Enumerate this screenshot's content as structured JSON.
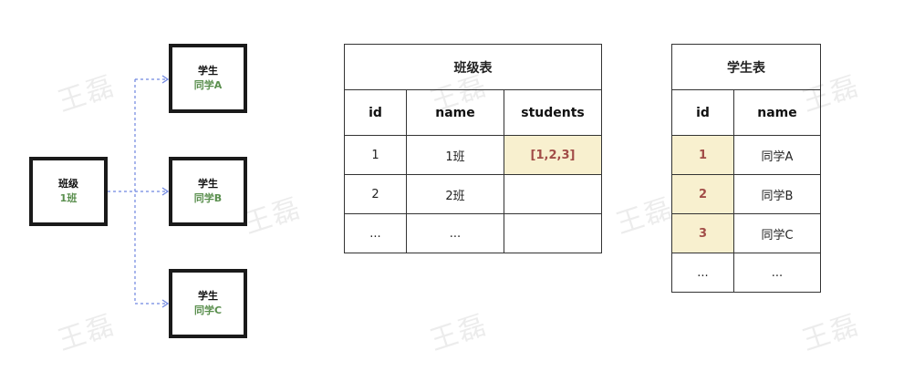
{
  "watermark": "王磊",
  "class_node": {
    "title": "班级",
    "name": "1班"
  },
  "student_nodes": [
    {
      "title": "学生",
      "name": "同学A"
    },
    {
      "title": "学生",
      "name": "同学B"
    },
    {
      "title": "学生",
      "name": "同学C"
    }
  ],
  "class_table": {
    "title": "班级表",
    "columns": [
      "id",
      "name",
      "students"
    ],
    "rows": [
      [
        "1",
        "1班",
        "[1,2,3]"
      ],
      [
        "2",
        "2班",
        ""
      ],
      [
        "...",
        "...",
        ""
      ]
    ]
  },
  "student_table": {
    "title": "学生表",
    "columns": [
      "id",
      "name"
    ],
    "rows": [
      [
        "1",
        "同学A"
      ],
      [
        "2",
        "同学B"
      ],
      [
        "3",
        "同学C"
      ],
      [
        "...",
        "..."
      ]
    ]
  },
  "colors": {
    "accent_green": "#5a8f4e",
    "highlight_bg": "#f8f0cf",
    "highlight_text": "#a24d48",
    "link_blue": "#6f86e0"
  }
}
